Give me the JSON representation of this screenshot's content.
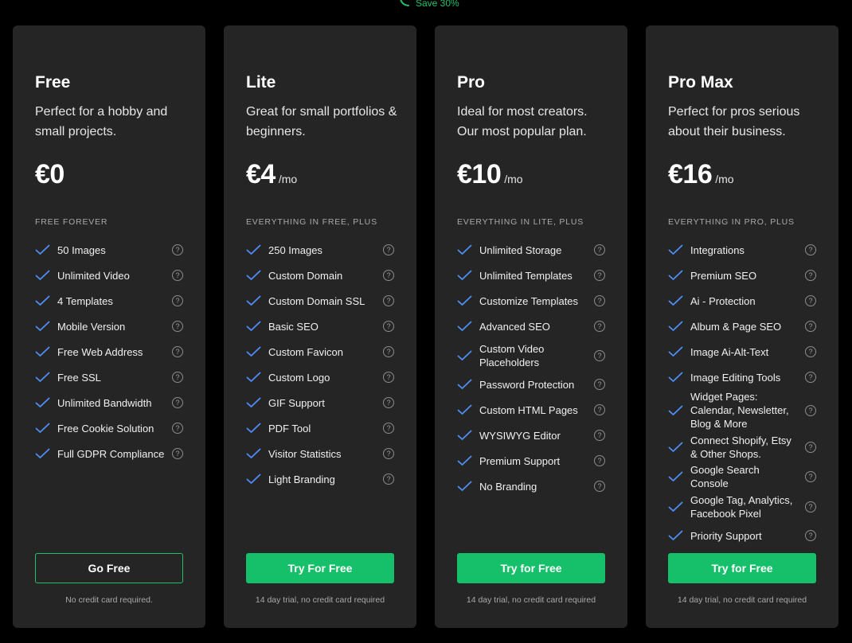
{
  "banner": {
    "save_label": "Save 30%",
    "accent": "#22c06a"
  },
  "plans": [
    {
      "name": "Free",
      "description": "Perfect for a hobby and small projects.",
      "price": "€0",
      "period": "",
      "section_label": "FREE FOREVER",
      "features": [
        "50 Images",
        "Unlimited Video",
        "4 Templates",
        "Mobile Version",
        "Free Web Address",
        "Free SSL",
        "Unlimited Bandwidth",
        "Free Cookie Solution",
        "Full GDPR Compliance"
      ],
      "cta": "Go Free",
      "note": "No credit card required."
    },
    {
      "name": "Lite",
      "description": "Great for small portfolios & beginners.",
      "price": "€4",
      "period": "/mo",
      "section_label": "EVERYTHING IN FREE, PLUS",
      "features": [
        "250 Images",
        "Custom Domain",
        "Custom Domain SSL",
        "Basic SEO",
        "Custom Favicon",
        "Custom Logo",
        "GIF Support",
        "PDF Tool",
        "Visitor Statistics",
        "Light Branding"
      ],
      "cta": "Try For Free",
      "note": "14 day trial, no credit card required"
    },
    {
      "name": "Pro",
      "description": "Ideal for most creators. Our most popular plan.",
      "price": "€10",
      "period": "/mo",
      "section_label": "EVERYTHING IN LITE, PLUS",
      "features": [
        "Unlimited Storage",
        "Unlimited Templates",
        "Customize Templates",
        "Advanced SEO",
        "Custom Video Placeholders",
        "Password Protection",
        "Custom HTML Pages",
        "WYSIWYG Editor",
        "Premium Support",
        "No Branding"
      ],
      "cta": "Try for Free",
      "note": "14 day trial, no credit card required"
    },
    {
      "name": "Pro Max",
      "description": "Perfect for pros serious about their business.",
      "price": "€16",
      "period": "/mo",
      "section_label": "EVERYTHING IN PRO, PLUS",
      "features": [
        "Integrations",
        "Premium SEO",
        "Ai - Protection",
        "Album & Page SEO",
        "Image Ai-Alt-Text",
        "Image Editing Tools",
        "Widget Pages: Calendar, Newsletter, Blog & More",
        "Connect Shopify, Etsy & Other Shops.",
        "Google Search Console",
        "Google Tag, Analytics, Facebook Pixel",
        "Priority Support"
      ],
      "cta": "Try for Free",
      "note": "14 day trial, no credit card required"
    }
  ]
}
